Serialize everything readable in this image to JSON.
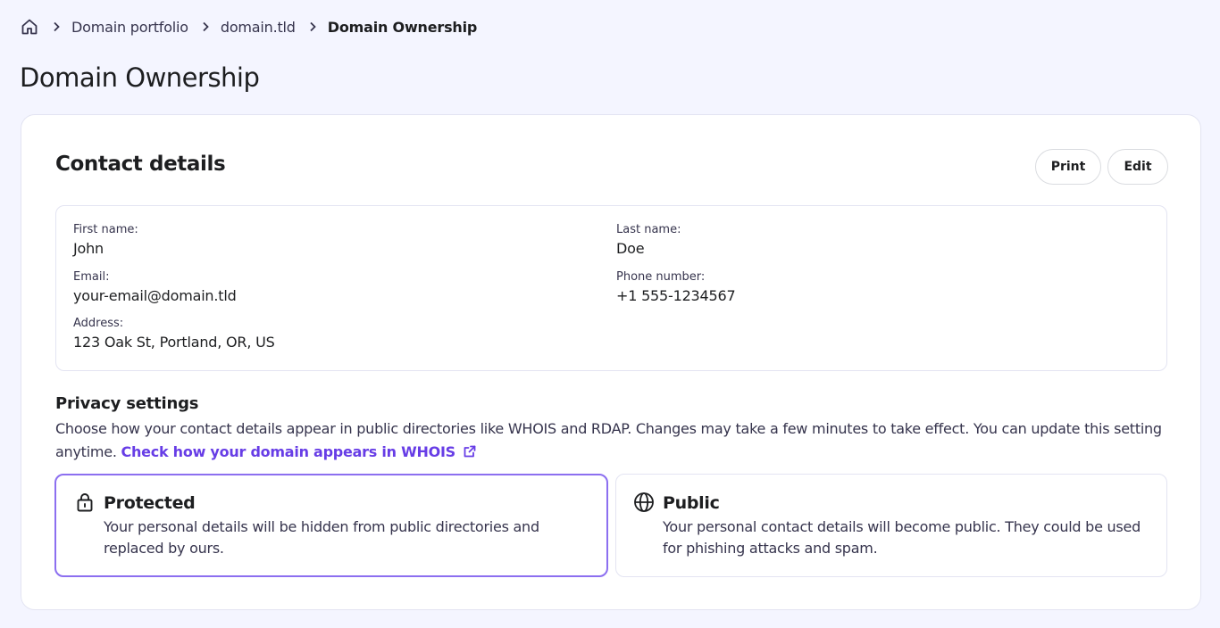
{
  "breadcrumb": {
    "items": [
      "Domain portfolio",
      "domain.tld"
    ],
    "current": "Domain Ownership"
  },
  "page": {
    "title": "Domain Ownership"
  },
  "contact": {
    "title": "Contact details",
    "print_label": "Print",
    "edit_label": "Edit",
    "first_name": {
      "label": "First name:",
      "value": "John"
    },
    "last_name": {
      "label": "Last name:",
      "value": "Doe"
    },
    "email": {
      "label": "Email:",
      "value": "your-email@domain.tld"
    },
    "phone": {
      "label": "Phone number:",
      "value": "+1 555-1234567"
    },
    "address": {
      "label": "Address:",
      "value": "123 Oak St, Portland, OR, US"
    }
  },
  "privacy": {
    "title": "Privacy settings",
    "description": "Choose how your contact details appear in public directories like WHOIS and RDAP. Changes may take a few minutes to take effect. You can update this setting anytime.",
    "link_text": "Check how your domain appears in WHOIS",
    "options": [
      {
        "title": "Protected",
        "description": "Your personal details will be hidden from public directories and replaced by ours.",
        "icon": "lock-icon",
        "selected": true
      },
      {
        "title": "Public",
        "description": "Your personal contact details will become public. They could be used for phishing attacks and spam.",
        "icon": "globe-icon",
        "selected": false
      }
    ]
  },
  "colors": {
    "accent": "#673de6",
    "selected_border": "#8c6ff0",
    "background": "#f4f5ff"
  }
}
